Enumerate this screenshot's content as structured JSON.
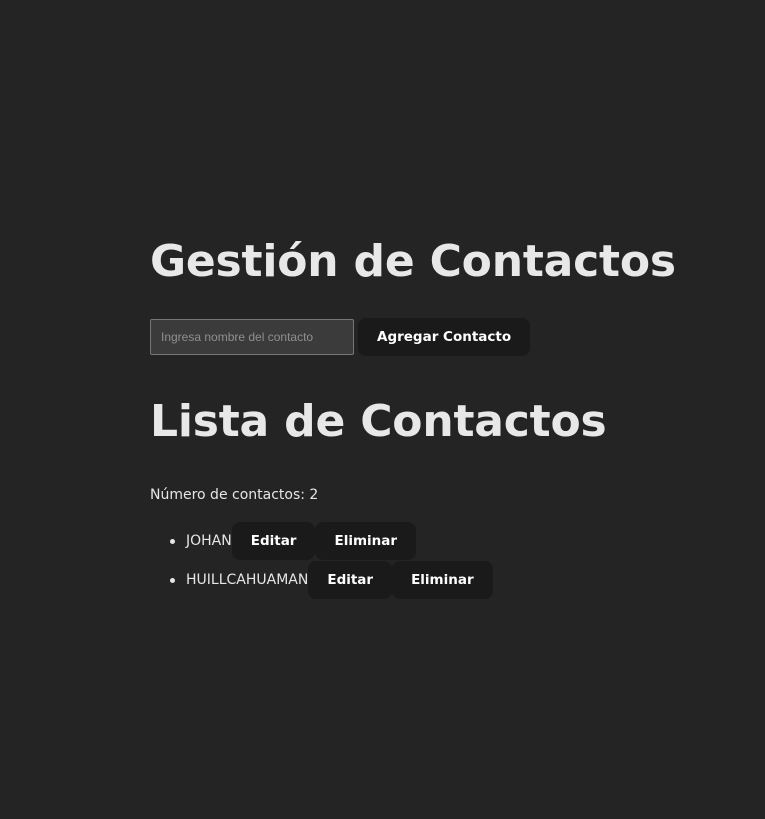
{
  "app": {
    "title": "Gestión de Contactos"
  },
  "form": {
    "input_value": "",
    "input_placeholder": "Ingresa nombre del contacto",
    "add_label": "Agregar Contacto"
  },
  "list": {
    "title": "Lista de Contactos",
    "count_label": "Número de contactos: 2",
    "items": [
      {
        "name": "JOHAN",
        "edit_label": "Editar",
        "delete_label": "Eliminar"
      },
      {
        "name": "HUILLCAHUAMAN",
        "edit_label": "Editar",
        "delete_label": "Eliminar"
      }
    ]
  },
  "colors": {
    "background": "#242424",
    "button_bg": "#1a1a1a",
    "text": "#e8e8e8"
  }
}
